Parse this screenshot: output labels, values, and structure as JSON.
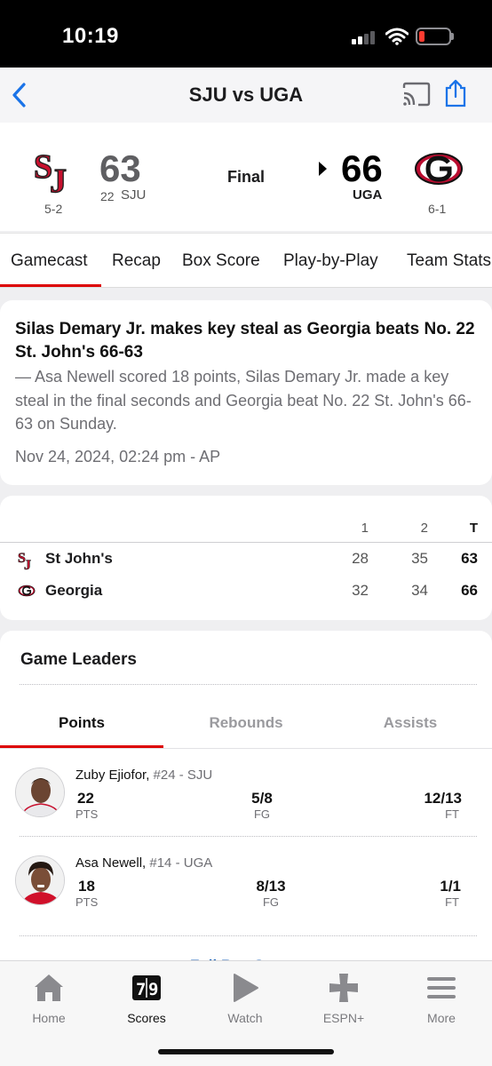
{
  "status_bar": {
    "time": "10:19"
  },
  "nav": {
    "title": "SJU vs UGA",
    "back_icon": "chevron-left-icon",
    "cast_icon": "cast-icon",
    "share_icon": "share-icon",
    "accent": "#1a73e8"
  },
  "scoreboard": {
    "away": {
      "record": "5-2",
      "score": "63",
      "rank": "22",
      "abbr": "SJU",
      "color": "#c8102e"
    },
    "status": "Final",
    "home": {
      "score": "66",
      "abbr": "UGA",
      "record": "6-1",
      "color": "#ba0c2f"
    }
  },
  "tabs": [
    "Gamecast",
    "Recap",
    "Box Score",
    "Play-by-Play",
    "Team Stats"
  ],
  "story": {
    "headline": "Silas Demary Jr. makes key steal as Georgia beats No. 22 St. John's 66-63",
    "body": "— Asa Newell scored 18 points, Silas Demary Jr. made a key steal in the final seconds and Georgia beat No. 22 St. John's 66-63 on Sunday.",
    "date": "Nov 24, 2024, 02:24 pm - AP"
  },
  "linescore": {
    "headers": [
      "1",
      "2",
      "T"
    ],
    "rows": [
      {
        "team": "St John's",
        "p1": "28",
        "p2": "35",
        "total": "63"
      },
      {
        "team": "Georgia",
        "p1": "32",
        "p2": "34",
        "total": "66"
      }
    ]
  },
  "leaders": {
    "title": "Game Leaders",
    "tabs": [
      "Points",
      "Rebounds",
      "Assists"
    ],
    "players": [
      {
        "name": "Zuby Ejiofor,",
        "meta": "#24 - SJU",
        "s1": "22",
        "l1": "PTS",
        "s2": "5/8",
        "l2": "FG",
        "s3": "12/13",
        "l3": "FT"
      },
      {
        "name": "Asa Newell,",
        "meta": "#14 - UGA",
        "s1": "18",
        "l1": "PTS",
        "s2": "8/13",
        "l2": "FG",
        "s3": "1/1",
        "l3": "FT"
      }
    ],
    "full_link": "Full Box Score"
  },
  "tabbar": [
    {
      "label": "Home",
      "icon": "home-icon"
    },
    {
      "label": "Scores",
      "icon": "scores-icon",
      "badge": "7 9"
    },
    {
      "label": "Watch",
      "icon": "play-icon"
    },
    {
      "label": "ESPN+",
      "icon": "plus-icon"
    },
    {
      "label": "More",
      "icon": "menu-icon"
    }
  ]
}
